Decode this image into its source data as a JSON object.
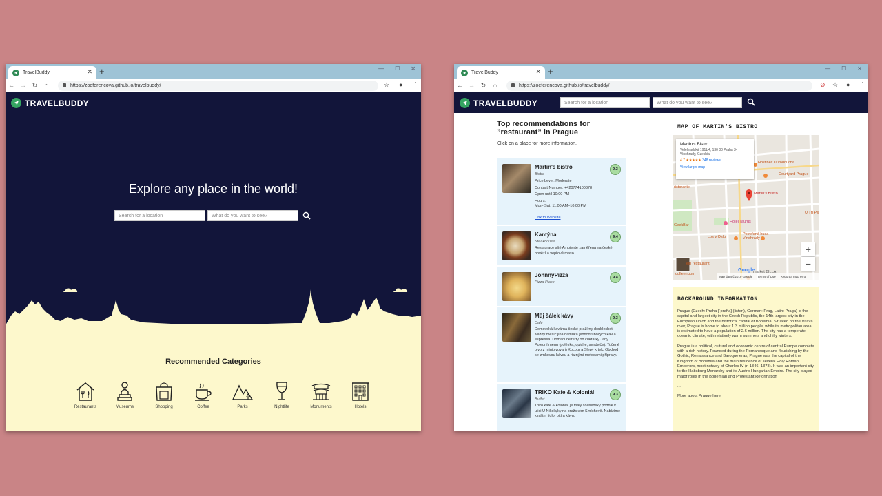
{
  "browser": {
    "tab_title": "TravelBuddy",
    "url": "https://zoeferencova.github.io/travelbuddy/"
  },
  "brand": {
    "name": "TRAVELBUDDY"
  },
  "home": {
    "headline": "Explore any place in the world!",
    "location_placeholder": "Search for a location",
    "query_placeholder": "What do you want to see?",
    "categories_title": "Recommended Categories",
    "categories": [
      {
        "label": "Restaurants",
        "icon": "restaurant-icon"
      },
      {
        "label": "Museums",
        "icon": "museum-icon"
      },
      {
        "label": "Shopping",
        "icon": "shopping-icon"
      },
      {
        "label": "Coffee",
        "icon": "coffee-icon"
      },
      {
        "label": "Parks",
        "icon": "parks-icon"
      },
      {
        "label": "Nightlife",
        "icon": "nightlife-icon"
      },
      {
        "label": "Monuments",
        "icon": "monument-icon"
      },
      {
        "label": "Hotels",
        "icon": "hotel-icon"
      }
    ]
  },
  "results": {
    "location_placeholder": "Search for a location",
    "query_placeholder": "What do you want to see?",
    "heading": "Top recommendations for ”restaurant” in Prague",
    "subheading": "Click on a place for more information.",
    "items": [
      {
        "name": "Martin's bistro",
        "type": "Bistro",
        "score": "9.3",
        "details": [
          "Price Level: Moderate",
          "Contact Number: +420774100378",
          "Open until 10:00 PM",
          "Hours:",
          "Mon- Sat: 11:00 AM–10:00 PM"
        ],
        "link": "Link to Website"
      },
      {
        "name": "Kantýna",
        "type": "Steakhouse",
        "score": "9.4",
        "description": "Restaurace sítě Ambiente zaměřená na české hovězí a vepřové maso."
      },
      {
        "name": "JohnnyPizza",
        "type": "Pizza Place",
        "score": "9.4"
      },
      {
        "name": "Můj šálek kávy",
        "type": "Café",
        "score": "9.3",
        "description": "Domovská kavárna české pražírny doubleshot. Každý měsíc jiná nabídka jednodruhových káv a espressa. Domácí dezerty od cukrářky Jany. Polední menu (polévka, quiche, sendviče). Točené pivo z minipivovarů Kocour a Slepý krtek. Obchod se zrnkovou kávou a různými metodami přípravy."
      },
      {
        "name": "TRIKO Kafe & Koloniál",
        "type": "Buffet",
        "score": "9.3",
        "description": "Triko kafe & koloniál je malý sousedský podnik v ulici U Nikolajky na pražském Smíchově. Nabízíme kvalitní jídlo, pití a kávu."
      }
    ],
    "map": {
      "title": "MAP OF MARTIN'S BISTRO",
      "card_name": "Martin's Bistro",
      "card_address": "Velehradská 1911/4, 130 00 Praha 3-Vinohrady, Czechia",
      "card_rating": "4.7 ★★★★★",
      "card_reviews": "348 reviews",
      "card_link": "View larger map",
      "marker_label": "Martin's Bistro",
      "labels": [
        "Hostinec U Vodoucha",
        "Courtyard Prague",
        "U Tří Ps",
        "Hotel Taurus",
        "Potrefená husa Vinohrady",
        "Los v Oslu",
        "GeekBar",
        "ristorante",
        "ein restaurant",
        "market BILLA",
        "coffee room"
      ],
      "footer": [
        "Map data ©2019 Google",
        "Terms of Use",
        "Report a map error"
      ],
      "google": "Google"
    },
    "background": {
      "title": "BACKGROUND INFORMATION",
      "p1": "Prague (Czech: Praha [ˈpraɦa] (listen), German: Prag, Latin: Praga) is the capital and largest city in the Czech Republic, the 14th largest city in the European Union and the historical capital of Bohemia. Situated on the Vltava river, Prague is home to about 1.3 million people, while its metropolitan area is estimated to have a population of 2.6 million. The city has a temperate oceanic climate, with relatively warm summers and chilly winters.",
      "p2": "Prague is a political, cultural and economic centre of central Europe complete with a rich history. Founded during the Romanesque and flourishing by the Gothic, Renaissance and Baroque eras, Prague was the capital of the Kingdom of Bohemia and the main residence of several Holy Roman Emperors, most notably of Charles IV (r. 1346–1378). It was an important city to the Habsburg Monarchy and its Austro-Hungarian Empire. The city played major roles in the Bohemian and Protestant Reformation",
      "ellipsis": "...",
      "more": "More about Prague here"
    }
  },
  "colors": {
    "navy": "#12153a",
    "cream": "#fdf8cc",
    "green": "#35a462",
    "list_bg": "#e6f3fb",
    "backdrop": "#c98486"
  }
}
